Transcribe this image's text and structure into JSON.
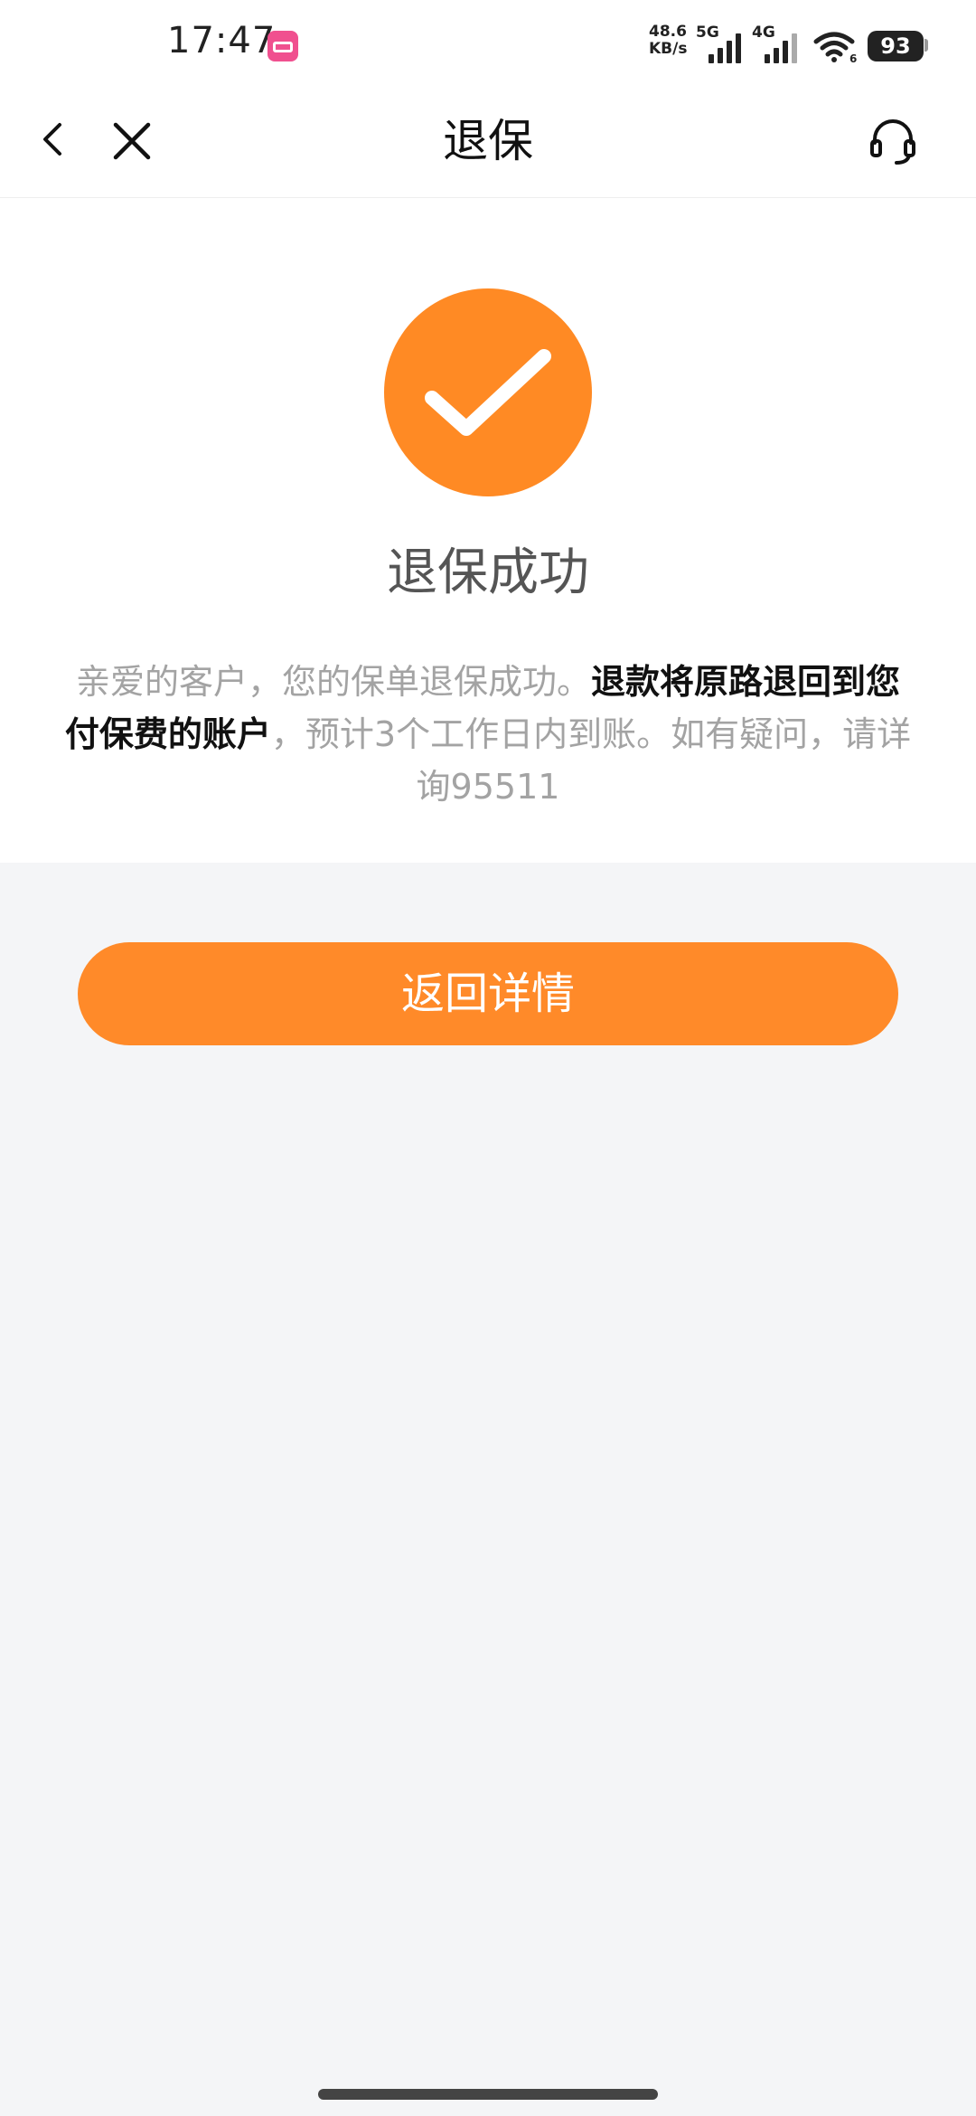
{
  "status_bar": {
    "time": "17:47",
    "net_speed_value": "48.6",
    "net_speed_unit": "KB/s",
    "network_5g": "5G",
    "network_4g": "4G",
    "wifi_badge": "6",
    "battery": "93"
  },
  "nav": {
    "title": "退保"
  },
  "result": {
    "title": "退保成功",
    "desc_part1": "亲爱的客户，您的保单退保成功。",
    "desc_bold": "退款将原路退回到您付保费的账户",
    "desc_part2": "，预计3个工作日内到账。如有疑问，请详询95511"
  },
  "actions": {
    "primary_label": "返回详情"
  },
  "colors": {
    "accent": "#FF8A24",
    "background": "#F4F5F7"
  },
  "icons": {
    "back": "chevron-left-icon",
    "close": "close-icon",
    "service": "headset-icon",
    "success": "checkmark-icon"
  }
}
